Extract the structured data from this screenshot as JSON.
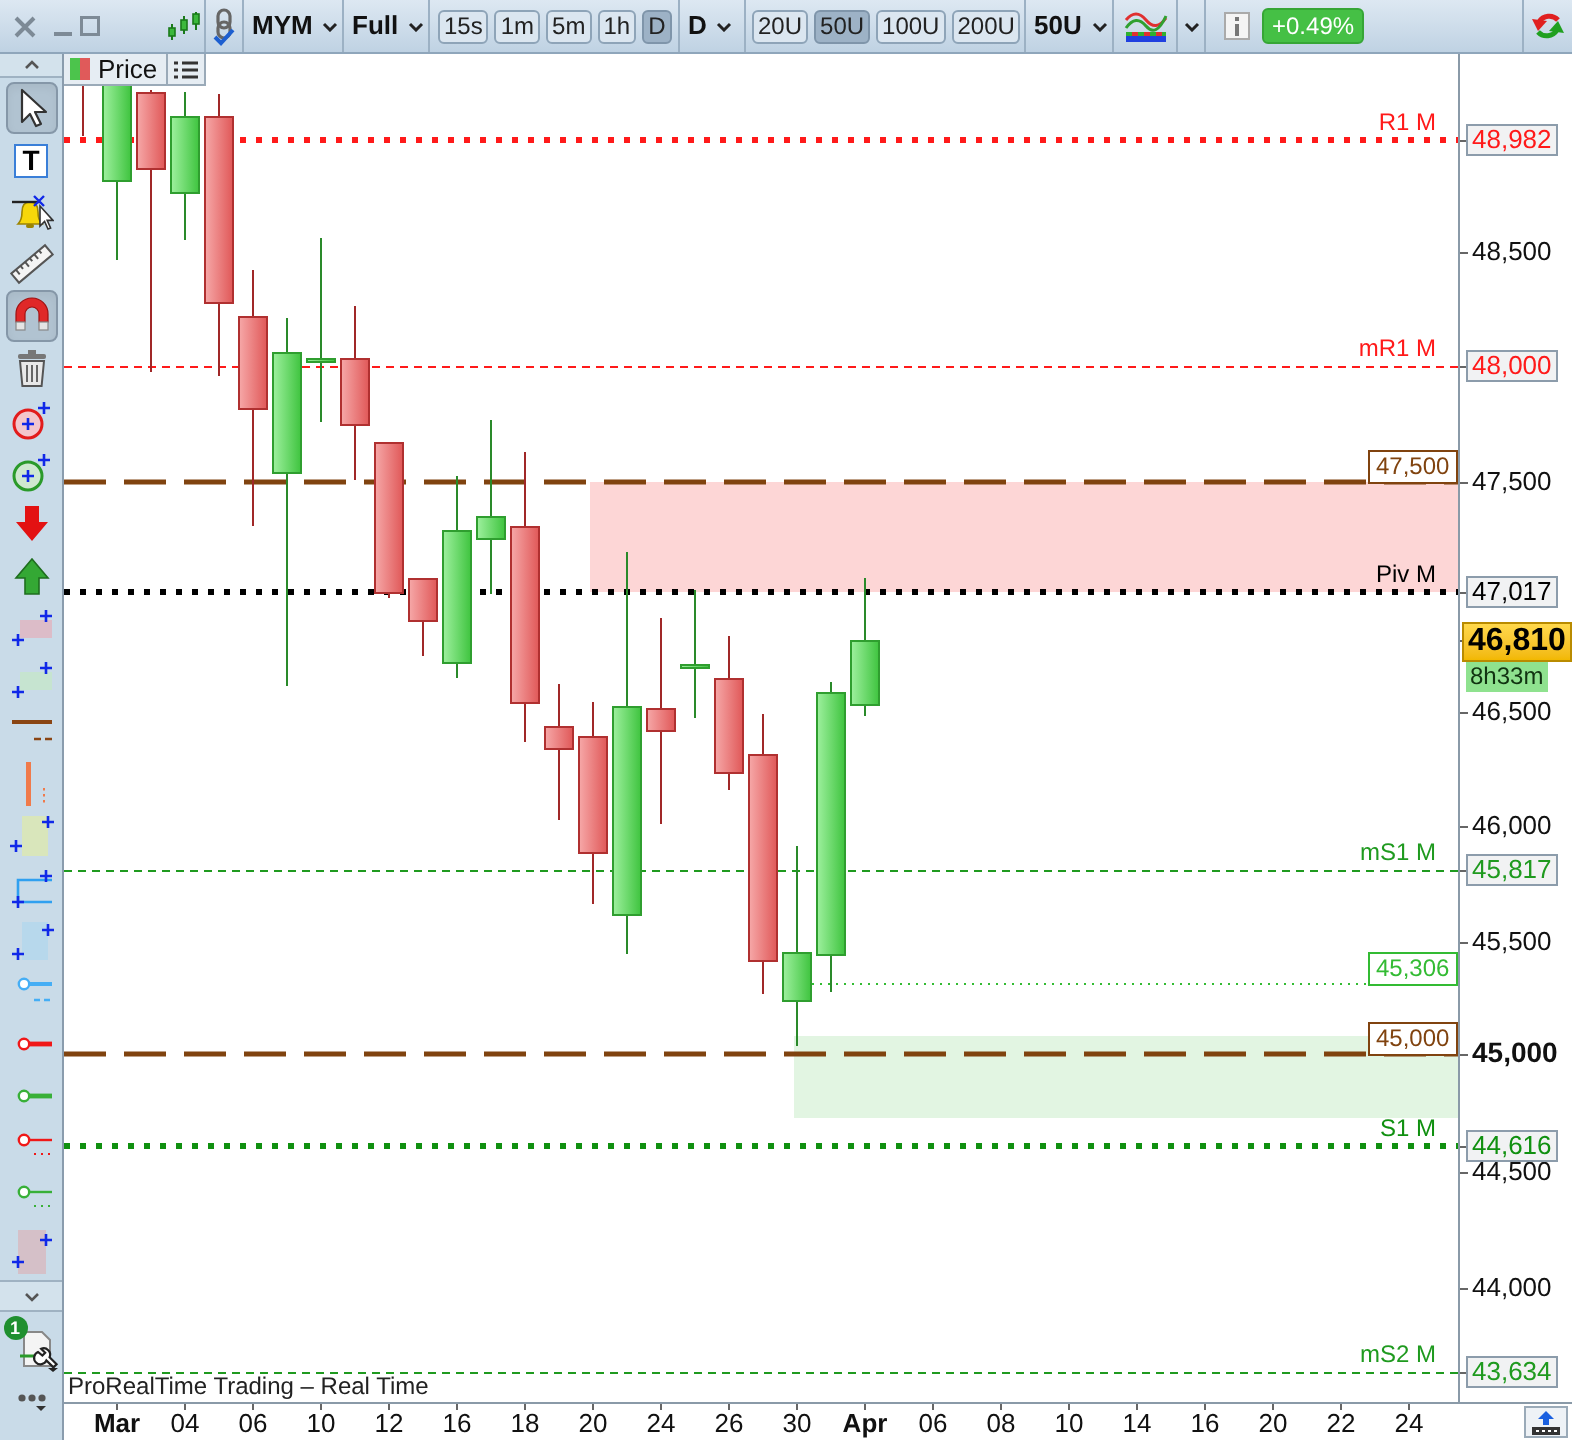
{
  "toolbar": {
    "symbol": "MYM",
    "chart_mode": "Full",
    "timeframes": [
      {
        "label": "15s",
        "selected": false
      },
      {
        "label": "1m",
        "selected": false
      },
      {
        "label": "5m",
        "selected": false
      },
      {
        "label": "1h",
        "selected": false
      },
      {
        "label": "D",
        "selected": true
      }
    ],
    "period": "D",
    "unit_presets": [
      {
        "label": "20U",
        "selected": false
      },
      {
        "label": "50U",
        "selected": true
      },
      {
        "label": "100U",
        "selected": false
      },
      {
        "label": "200U",
        "selected": false
      }
    ],
    "units": "50U",
    "change": "+0.49%"
  },
  "drawing_tools": [
    {
      "kind": "pointer",
      "selected": true
    },
    {
      "kind": "text",
      "selected": false,
      "label": "T"
    },
    {
      "kind": "alert",
      "selected": false
    },
    {
      "kind": "ruler",
      "selected": false
    },
    {
      "kind": "magnet",
      "selected": true
    },
    {
      "kind": "trash",
      "selected": false
    },
    {
      "kind": "addred",
      "selected": false
    },
    {
      "kind": "addgreen",
      "selected": false
    },
    {
      "kind": "sell",
      "selected": false
    },
    {
      "kind": "buy",
      "selected": false
    },
    {
      "kind": "redzone",
      "selected": false
    },
    {
      "kind": "greenzone",
      "selected": false
    },
    {
      "kind": "hline",
      "selected": false
    },
    {
      "kind": "vline",
      "selected": false
    },
    {
      "kind": "yzone",
      "selected": false
    },
    {
      "kind": "channel",
      "selected": false
    },
    {
      "kind": "bluezone",
      "selected": false
    },
    {
      "kind": "blueray",
      "selected": false
    },
    {
      "kind": "redray",
      "selected": false
    },
    {
      "kind": "greenray",
      "selected": false
    },
    {
      "kind": "reddots",
      "selected": false
    },
    {
      "kind": "greendots",
      "selected": false
    },
    {
      "kind": "pinkzone",
      "selected": false
    }
  ],
  "tools_badge": "1",
  "chart": {
    "legend": "Price",
    "footer": "ProRealTime Trading – Real Time",
    "levels": [
      {
        "label": "R1 M",
        "price": "48,982",
        "color": "#ff1a1a",
        "kind": "dotted"
      },
      {
        "label": "mR1 M",
        "price": "48,000",
        "color": "#ff1a1a",
        "kind": "dashed"
      },
      {
        "label": "Piv M",
        "price": "47,017",
        "color": "#000000",
        "kind": "dotted"
      },
      {
        "label": "mS1 M",
        "price": "45,817",
        "color": "#1f9a1f",
        "kind": "dashed"
      },
      {
        "label": "S1 M",
        "price": "44,616",
        "color": "#109010",
        "kind": "dotted"
      },
      {
        "label": "mS2 M",
        "price": "43,634",
        "color": "#1f9a1f",
        "kind": "dashed"
      }
    ],
    "lines": [
      {
        "label": "47,500",
        "kind": "dashed",
        "color": "#80430f"
      },
      {
        "label": "45,306",
        "kind": "dotted",
        "color": "#33bb33"
      },
      {
        "label": "45,000",
        "kind": "dashed",
        "color": "#80430f"
      }
    ],
    "zones": [
      {
        "color": "#fdd6d6"
      },
      {
        "color": "#e2f5e2"
      }
    ]
  },
  "price_axis": {
    "ticks": [
      {
        "label": "48,500",
        "bold": false
      },
      {
        "label": "47,500",
        "bold": false
      },
      {
        "label": "46,500",
        "bold": false
      },
      {
        "label": "46,000",
        "bold": false
      },
      {
        "label": "45,500",
        "bold": false
      },
      {
        "label": "45,000",
        "bold": true
      },
      {
        "label": "44,500",
        "bold": false
      },
      {
        "label": "44,000",
        "bold": false
      }
    ],
    "current_price": "46,810",
    "countdown": "8h33m"
  },
  "time_axis": {
    "labels": [
      {
        "label": "Mar",
        "bold": true
      },
      {
        "label": "04",
        "bold": false
      },
      {
        "label": "06",
        "bold": false
      },
      {
        "label": "10",
        "bold": false
      },
      {
        "label": "12",
        "bold": false
      },
      {
        "label": "16",
        "bold": false
      },
      {
        "label": "18",
        "bold": false
      },
      {
        "label": "20",
        "bold": false
      },
      {
        "label": "24",
        "bold": false
      },
      {
        "label": "26",
        "bold": false
      },
      {
        "label": "30",
        "bold": false
      },
      {
        "label": "Apr",
        "bold": true
      },
      {
        "label": "06",
        "bold": false
      },
      {
        "label": "08",
        "bold": false
      },
      {
        "label": "10",
        "bold": false
      },
      {
        "label": "14",
        "bold": false
      },
      {
        "label": "16",
        "bold": false
      },
      {
        "label": "20",
        "bold": false
      },
      {
        "label": "22",
        "bold": false
      },
      {
        "label": "24",
        "bold": false
      }
    ]
  }
}
